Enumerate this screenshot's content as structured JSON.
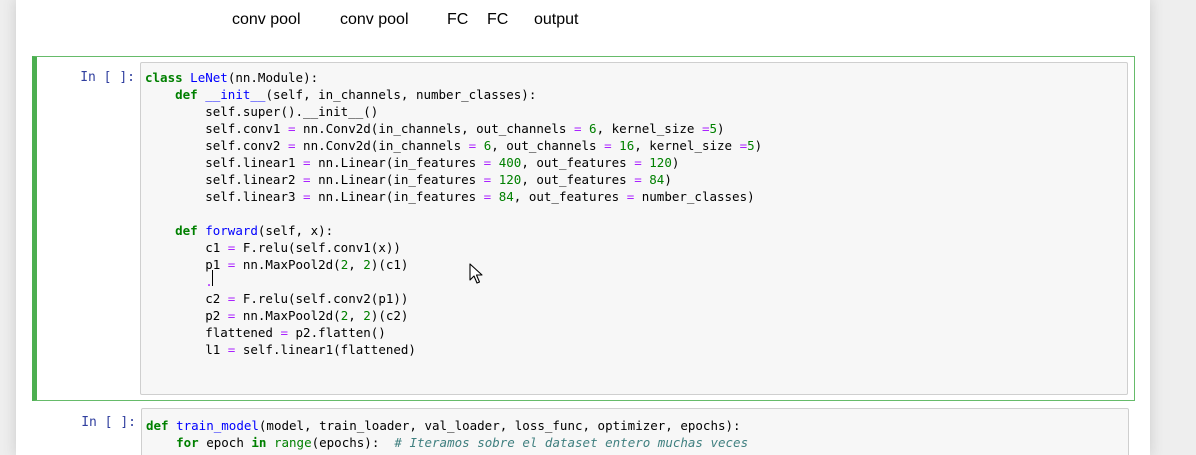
{
  "markdown_header": {
    "words": [
      "conv pool",
      "conv pool",
      "FC",
      "FC",
      "output"
    ]
  },
  "cells": [
    {
      "prompt": "In [ ]:",
      "lines": [
        [
          {
            "t": "class",
            "c": "kw"
          },
          {
            "t": " ",
            "c": "n"
          },
          {
            "t": "LeNet",
            "c": "def"
          },
          {
            "t": "(nn.Module):",
            "c": "n"
          }
        ],
        [
          {
            "t": "    ",
            "c": "n"
          },
          {
            "t": "def",
            "c": "kw"
          },
          {
            "t": " ",
            "c": "n"
          },
          {
            "t": "__init__",
            "c": "def"
          },
          {
            "t": "(self, in_channels, number_classes):",
            "c": "n"
          }
        ],
        [
          {
            "t": "        self.super().__init__()",
            "c": "n"
          }
        ],
        [
          {
            "t": "        self.conv1 ",
            "c": "n"
          },
          {
            "t": "=",
            "c": "op"
          },
          {
            "t": " nn.Conv2d(in_channels, out_channels ",
            "c": "n"
          },
          {
            "t": "=",
            "c": "op"
          },
          {
            "t": " ",
            "c": "n"
          },
          {
            "t": "6",
            "c": "num"
          },
          {
            "t": ", kernel_size ",
            "c": "n"
          },
          {
            "t": "=",
            "c": "op"
          },
          {
            "t": "5",
            "c": "num"
          },
          {
            "t": ")",
            "c": "n"
          }
        ],
        [
          {
            "t": "        self.conv2 ",
            "c": "n"
          },
          {
            "t": "=",
            "c": "op"
          },
          {
            "t": " nn.Conv2d(in_channels ",
            "c": "n"
          },
          {
            "t": "=",
            "c": "op"
          },
          {
            "t": " ",
            "c": "n"
          },
          {
            "t": "6",
            "c": "num"
          },
          {
            "t": ", out_channels ",
            "c": "n"
          },
          {
            "t": "=",
            "c": "op"
          },
          {
            "t": " ",
            "c": "n"
          },
          {
            "t": "16",
            "c": "num"
          },
          {
            "t": ", kernel_size ",
            "c": "n"
          },
          {
            "t": "=",
            "c": "op"
          },
          {
            "t": "5",
            "c": "num"
          },
          {
            "t": ")",
            "c": "n"
          }
        ],
        [
          {
            "t": "        self.linear1 ",
            "c": "n"
          },
          {
            "t": "=",
            "c": "op"
          },
          {
            "t": " nn.Linear(in_features ",
            "c": "n"
          },
          {
            "t": "=",
            "c": "op"
          },
          {
            "t": " ",
            "c": "n"
          },
          {
            "t": "400",
            "c": "num"
          },
          {
            "t": ", out_features ",
            "c": "n"
          },
          {
            "t": "=",
            "c": "op"
          },
          {
            "t": " ",
            "c": "n"
          },
          {
            "t": "120",
            "c": "num"
          },
          {
            "t": ")",
            "c": "n"
          }
        ],
        [
          {
            "t": "        self.linear2 ",
            "c": "n"
          },
          {
            "t": "=",
            "c": "op"
          },
          {
            "t": " nn.Linear(in_features ",
            "c": "n"
          },
          {
            "t": "=",
            "c": "op"
          },
          {
            "t": " ",
            "c": "n"
          },
          {
            "t": "120",
            "c": "num"
          },
          {
            "t": ", out_features ",
            "c": "n"
          },
          {
            "t": "=",
            "c": "op"
          },
          {
            "t": " ",
            "c": "n"
          },
          {
            "t": "84",
            "c": "num"
          },
          {
            "t": ")",
            "c": "n"
          }
        ],
        [
          {
            "t": "        self.linear3 ",
            "c": "n"
          },
          {
            "t": "=",
            "c": "op"
          },
          {
            "t": " nn.Linear(in_features ",
            "c": "n"
          },
          {
            "t": "=",
            "c": "op"
          },
          {
            "t": " ",
            "c": "n"
          },
          {
            "t": "84",
            "c": "num"
          },
          {
            "t": ", out_features ",
            "c": "n"
          },
          {
            "t": "=",
            "c": "op"
          },
          {
            "t": " number_classes)",
            "c": "n"
          }
        ],
        [
          {
            "t": "",
            "c": "n"
          }
        ],
        [
          {
            "t": "    ",
            "c": "n"
          },
          {
            "t": "def",
            "c": "kw"
          },
          {
            "t": " ",
            "c": "n"
          },
          {
            "t": "forward",
            "c": "def"
          },
          {
            "t": "(self, x):",
            "c": "n"
          }
        ],
        [
          {
            "t": "        c1 ",
            "c": "n"
          },
          {
            "t": "=",
            "c": "op"
          },
          {
            "t": " F.relu(self.conv1(x))",
            "c": "n"
          }
        ],
        [
          {
            "t": "        p1 ",
            "c": "n"
          },
          {
            "t": "=",
            "c": "op"
          },
          {
            "t": " nn.MaxPool2d(",
            "c": "n"
          },
          {
            "t": "2",
            "c": "num"
          },
          {
            "t": ", ",
            "c": "n"
          },
          {
            "t": "2",
            "c": "num"
          },
          {
            "t": ")(c1)",
            "c": "n"
          }
        ],
        [
          {
            "t": "        ",
            "c": "n"
          },
          {
            "t": ".",
            "c": "op"
          }
        ],
        [
          {
            "t": "        c2 ",
            "c": "n"
          },
          {
            "t": "=",
            "c": "op"
          },
          {
            "t": " F.relu(self.conv2(p1))",
            "c": "n"
          }
        ],
        [
          {
            "t": "        p2 ",
            "c": "n"
          },
          {
            "t": "=",
            "c": "op"
          },
          {
            "t": " nn.MaxPool2d(",
            "c": "n"
          },
          {
            "t": "2",
            "c": "num"
          },
          {
            "t": ", ",
            "c": "n"
          },
          {
            "t": "2",
            "c": "num"
          },
          {
            "t": ")(c2)",
            "c": "n"
          }
        ],
        [
          {
            "t": "        flattened ",
            "c": "n"
          },
          {
            "t": "=",
            "c": "op"
          },
          {
            "t": " p2.flatten()",
            "c": "n"
          }
        ],
        [
          {
            "t": "        l1 ",
            "c": "n"
          },
          {
            "t": "=",
            "c": "op"
          },
          {
            "t": " self.linear1(flattened)",
            "c": "n"
          }
        ]
      ]
    },
    {
      "prompt": "In [ ]:",
      "lines": [
        [
          {
            "t": "def",
            "c": "kw"
          },
          {
            "t": " ",
            "c": "n"
          },
          {
            "t": "train_model",
            "c": "def"
          },
          {
            "t": "(model, train_loader, val_loader, loss_func, optimizer, epochs):",
            "c": "n"
          }
        ],
        [
          {
            "t": "    ",
            "c": "n"
          },
          {
            "t": "for",
            "c": "kw"
          },
          {
            "t": " epoch ",
            "c": "n"
          },
          {
            "t": "in",
            "c": "kw"
          },
          {
            "t": " ",
            "c": "n"
          },
          {
            "t": "range",
            "c": "bi"
          },
          {
            "t": "(epochs):  ",
            "c": "n"
          },
          {
            "t": "# Iteramos sobre el dataset entero muchas veces",
            "c": "cm"
          }
        ]
      ]
    }
  ],
  "theme": {
    "selected_cell_border": "#4caf50",
    "prompt_color": "#303f9f",
    "keyword_color": "#008000",
    "def_name_color": "#0000ff",
    "operator_color": "#aa22ff",
    "comment_color": "#408080"
  },
  "icons": {
    "mouse_pointer": "arrow-cursor-icon"
  }
}
